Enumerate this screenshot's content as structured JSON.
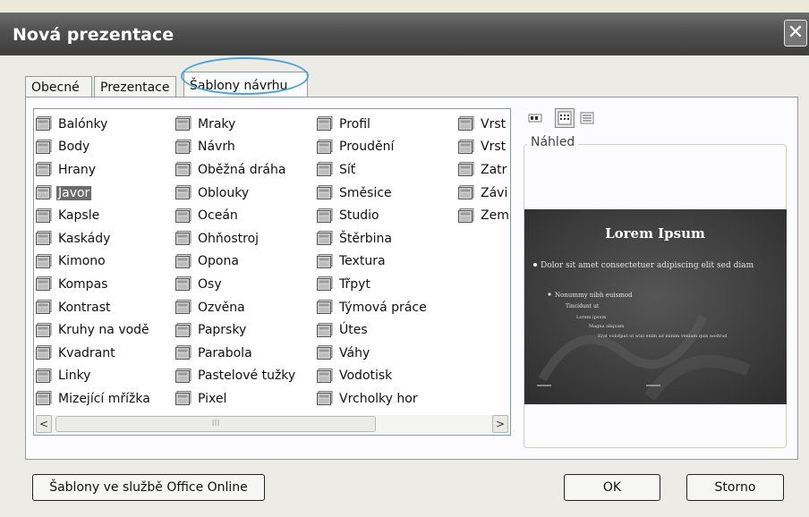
{
  "dialog": {
    "title": "Nová prezentace",
    "close_glyph": "✕"
  },
  "tabs": [
    {
      "label": "Obecné"
    },
    {
      "label": "Prezentace"
    },
    {
      "label": "Šablony návrhu"
    }
  ],
  "templates": {
    "columns": [
      [
        "Balónky",
        "Body",
        "Hrany",
        "Javor",
        "Kapsle",
        "Kaskády",
        "Kimono",
        "Kompas",
        "Kontrast",
        "Kruhy na vodě",
        "Kvadrant",
        "Linky",
        "Mizející mřížka"
      ],
      [
        "Mraky",
        "Návrh",
        "Oběžná dráha",
        "Oblouky",
        "Oceán",
        "Ohňostroj",
        "Opona",
        "Osy",
        "Ozvěna",
        "Paprsky",
        "Parabola",
        "Pastelové tužky",
        "Pixel"
      ],
      [
        "Profil",
        "Proudění",
        "Síť",
        "Směsice",
        "Studio",
        "Štěrbina",
        "Textura",
        "Třpyt",
        "Týmová práce",
        "Útes",
        "Váhy",
        "Vodotisk",
        "Vrcholky hor"
      ],
      [
        "Vrst",
        "Vrst",
        "Zatr",
        "Závi",
        "Zem"
      ]
    ],
    "selected": "Javor"
  },
  "scrollbar": {
    "left_arrow": "<",
    "right_arrow": ">",
    "grip": "III"
  },
  "preview": {
    "label": "Náhled",
    "slide": {
      "title": "Lorem Ipsum",
      "bullet1": "Dolor sit amet consectetuer adipiscing elit sed diam",
      "bullet2": "Nonummy nibh euismod",
      "bullet3": "Tincidunt ut",
      "bullet4": "Lorem ipsum",
      "bullet5": "Magna aliquam",
      "bullet6": "Erat volutpat ut wisi enim ad minim veniam quis nostrud"
    }
  },
  "buttons": {
    "online": "Šablony ve službě Office Online",
    "ok": "OK",
    "cancel": "Storno"
  }
}
